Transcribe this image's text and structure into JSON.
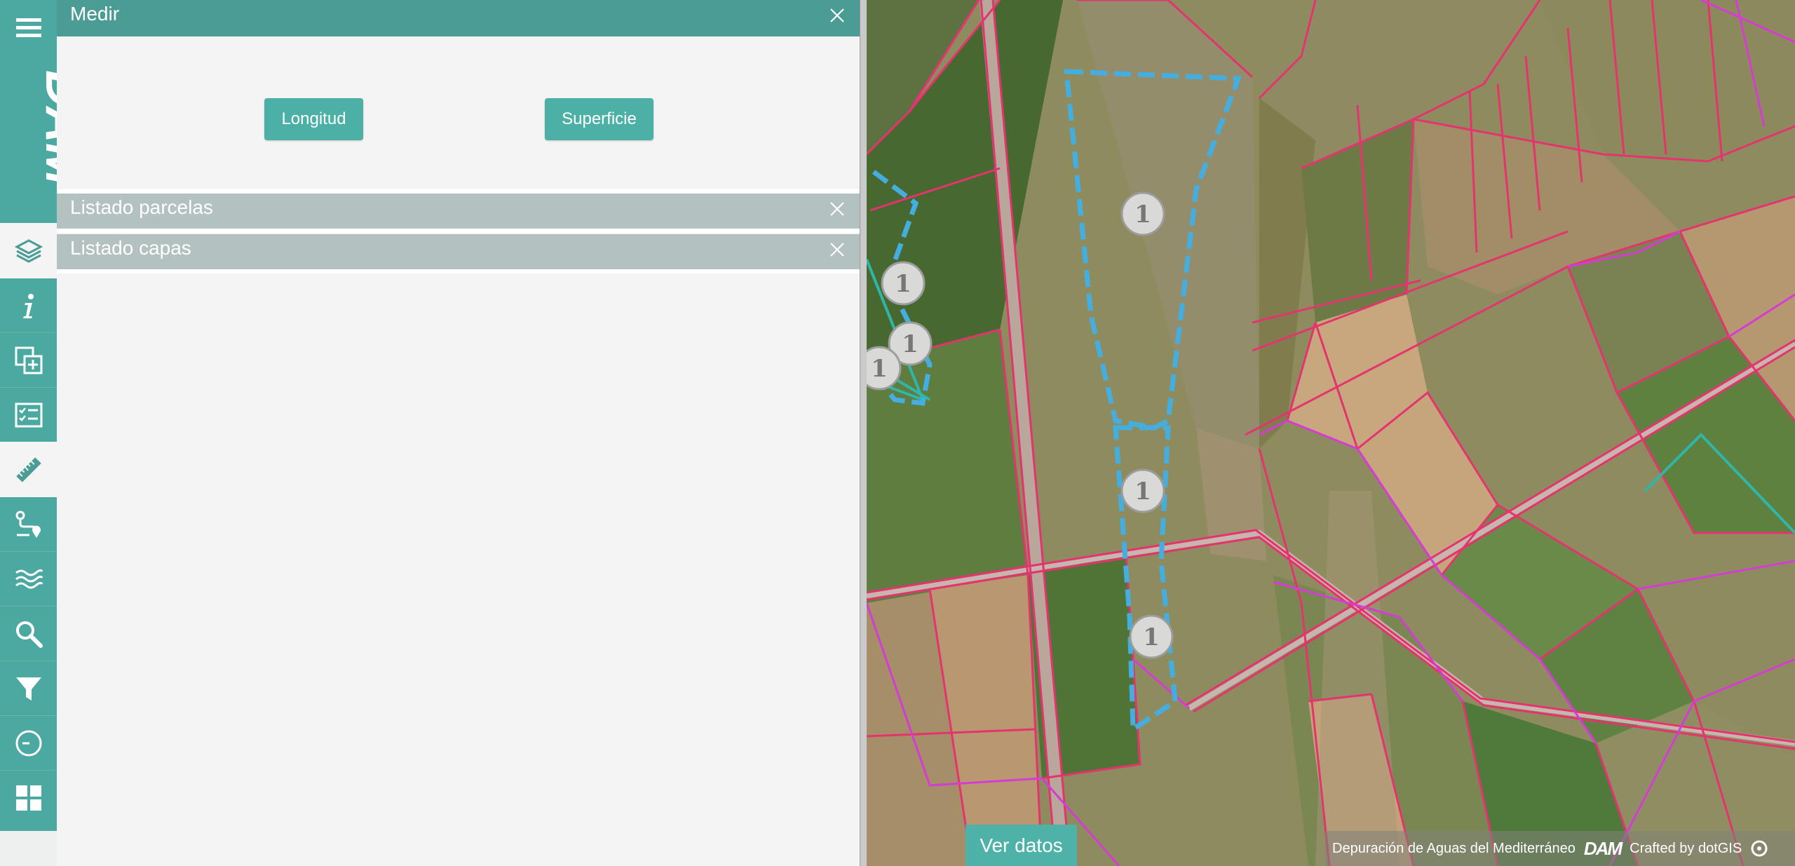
{
  "rail": {
    "tools": [
      {
        "name": "layers",
        "icon": "layers-icon",
        "active": true
      },
      {
        "name": "info",
        "icon": "info-icon",
        "active": false
      },
      {
        "name": "add-layer",
        "icon": "add-layer-icon",
        "active": false
      },
      {
        "name": "checklist",
        "icon": "checklist-icon",
        "active": false
      },
      {
        "name": "measure",
        "icon": "ruler-icon",
        "active": true
      },
      {
        "name": "route",
        "icon": "route-icon",
        "active": false
      },
      {
        "name": "water",
        "icon": "water-icon",
        "active": false
      },
      {
        "name": "search",
        "icon": "search-icon",
        "active": false
      },
      {
        "name": "filter",
        "icon": "filter-icon",
        "active": false
      },
      {
        "name": "time",
        "icon": "clock-icon",
        "active": false
      },
      {
        "name": "grid",
        "icon": "grid-icon",
        "active": false
      }
    ],
    "logo_text": "DAM"
  },
  "panel": {
    "medir_title": "Medir",
    "btn_longitud": "Longitud",
    "btn_superficie": "Superficie",
    "parcelas_title": "Listado parcelas",
    "capas_title": "Listado capas"
  },
  "map": {
    "markers": [
      "1",
      "1",
      "1",
      "1",
      "1",
      "1"
    ],
    "ver_datos": "Ver datos",
    "attribution": "Depuración de Aguas del Mediterráneo",
    "attribution_logo": "DAM",
    "crafted": "Crafted by dotGIS"
  },
  "colors": {
    "accent": "#4ba9a1",
    "panel_header": "#4b9c95",
    "panel_header_gray": "#b3c2c0",
    "parcel_pink": "#e5336f",
    "parcel_magenta": "#d63bd6",
    "dashed_blue": "#45aee0"
  }
}
